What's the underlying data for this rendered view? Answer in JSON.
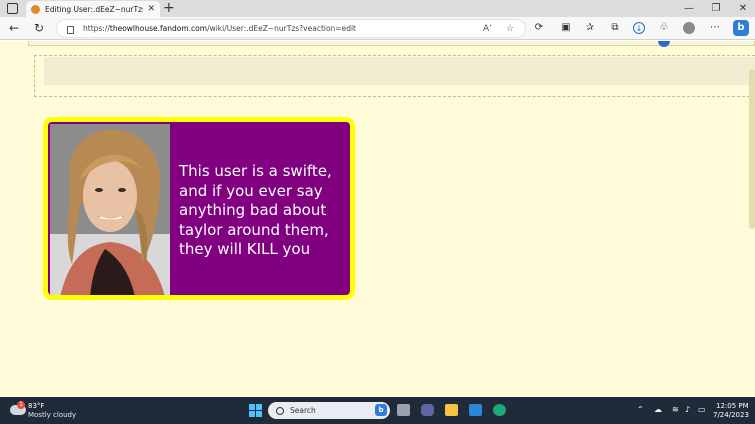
{
  "browser": {
    "tab_title": "Editing User:.dEeZ~nurTzs | The C",
    "tab_close": "✕",
    "new_tab": "+",
    "window_minimize": "—",
    "window_maximize": "❐",
    "window_close": "✕",
    "url_prefix": "https://",
    "url_host": "theowlhouse.fandom.com",
    "url_path": "/wiki/User:.dEeZ~nurTzs?veaction=edit",
    "read_aloud_icon": "A’",
    "favorite_icon": "☆"
  },
  "page": {
    "userbox_text": "This user is a swifte, and if you ever say anything bad about taylor around them, they will KILL you",
    "userbox_colors": {
      "border": "#ffff00",
      "background": "#800080",
      "text": "#ffffff"
    },
    "background_color": "#fffbd8"
  },
  "taskbar": {
    "weather_badge": "1",
    "weather_temp": "83°F",
    "weather_desc": "Mostly cloudy",
    "search_placeholder": "Search",
    "clock_time": "12:05 PM",
    "clock_date": "7/24/2023"
  }
}
